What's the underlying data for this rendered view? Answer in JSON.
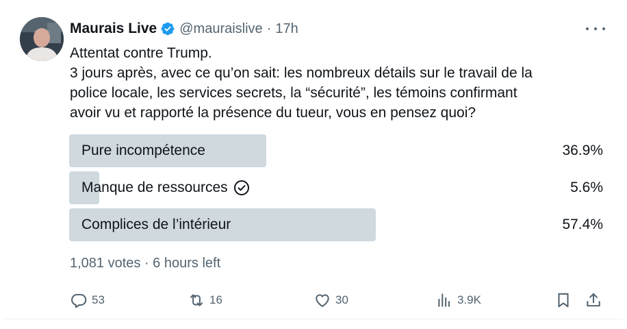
{
  "tweet": {
    "author_name": "Maurais Live",
    "handle": "@mauraislive",
    "separator": "·",
    "time": "17h",
    "text_lines": [
      "Attentat contre Trump.",
      "3 jours après, avec ce qu’on sait: les nombreux détails sur le travail de la",
      "police locale, les services secrets, la “sécurité”, les témoins confirmant",
      "avoir vu et rapporté la présence du tueur, vous en pensez quoi?"
    ]
  },
  "poll": {
    "options": [
      {
        "label": "Pure incompétence",
        "percent": "36.9%",
        "fraction": 0.369,
        "selected": false
      },
      {
        "label": "Manque de ressources",
        "percent": "5.6%",
        "fraction": 0.056,
        "selected": true
      },
      {
        "label": "Complices de l’intérieur",
        "percent": "57.4%",
        "fraction": 0.574,
        "selected": false
      }
    ],
    "summary": "1,081 votes · 6 hours left"
  },
  "actions": {
    "replies": "53",
    "reposts": "16",
    "likes": "30",
    "views": "3.9K"
  },
  "icons": {
    "verified": "verified-badge-icon",
    "more": "more-options-icon",
    "reply": "reply-icon",
    "repost": "repost-icon",
    "like": "heart-icon",
    "views": "analytics-icon",
    "bookmark": "bookmark-icon",
    "share": "share-icon",
    "selected": "check-circle-icon"
  },
  "colors": {
    "text": "#0f1419",
    "secondary": "#536471",
    "poll_bar": "#cfd9de",
    "verified": "#1d9bf0"
  }
}
